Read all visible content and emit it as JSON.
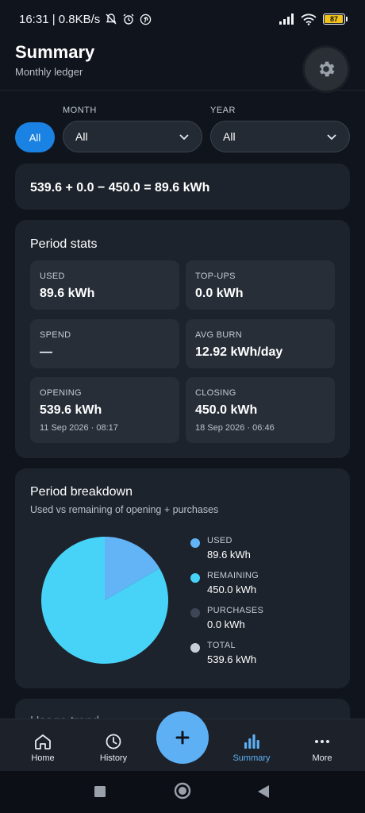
{
  "status_bar": {
    "time_speed": "16:31 | 0.8KB/s",
    "battery": "87",
    "battery_level": 0.87
  },
  "header": {
    "title": "Summary",
    "subtitle": "Monthly ledger",
    "settings_icon": "gear-icon"
  },
  "filters": {
    "all_chip": "All",
    "month_label": "MONTH",
    "month_value": "All",
    "year_label": "YEAR",
    "year_value": "All"
  },
  "formula": "539.6 + 0.0 − 450.0 = 89.6 kWh",
  "period_stats": {
    "title": "Period stats",
    "items": [
      {
        "label": "USED",
        "value": "89.6 kWh"
      },
      {
        "label": "TOP-UPS",
        "value": "0.0 kWh"
      },
      {
        "label": "SPEND",
        "value": "—"
      },
      {
        "label": "AVG BURN",
        "value": "12.92 kWh/day"
      },
      {
        "label": "OPENING",
        "value": "539.6 kWh",
        "date": "11 Sep 2026 · 08:17"
      },
      {
        "label": "CLOSING",
        "value": "450.0 kWh",
        "date": "18 Sep 2026 · 06:46"
      }
    ]
  },
  "breakdown": {
    "title": "Period breakdown",
    "subtitle": "Used vs remaining of opening + purchases",
    "legend": [
      {
        "label": "USED",
        "value": "89.6 kWh",
        "color": "#63b3f7"
      },
      {
        "label": "REMAINING",
        "value": "450.0 kWh",
        "color": "#47d3f7"
      },
      {
        "label": "PURCHASES",
        "value": "0.0 kWh",
        "color": "#3c4654"
      },
      {
        "label": "TOTAL",
        "value": "539.6 kWh",
        "color": "#c9ced6"
      }
    ]
  },
  "chart_data": {
    "type": "pie",
    "categories": [
      "USED",
      "REMAINING",
      "PURCHASES"
    ],
    "values": [
      89.6,
      450.0,
      0.0
    ],
    "colors": [
      "#63b3f7",
      "#47d3f7",
      "#3c4654"
    ]
  },
  "next_section_title": "Usage trend",
  "bottom_nav": {
    "items": [
      {
        "label": "Home",
        "icon": "home-icon"
      },
      {
        "label": "History",
        "icon": "history-icon"
      },
      {
        "label": "Summary",
        "icon": "bar-chart-icon",
        "active": true
      },
      {
        "label": "More",
        "icon": "more-icon"
      }
    ],
    "fab": "+"
  },
  "colors": {
    "accent": "#1a82e2",
    "active_nav": "#5eb0f5",
    "background": "#10151d",
    "card": "#1d232c"
  }
}
